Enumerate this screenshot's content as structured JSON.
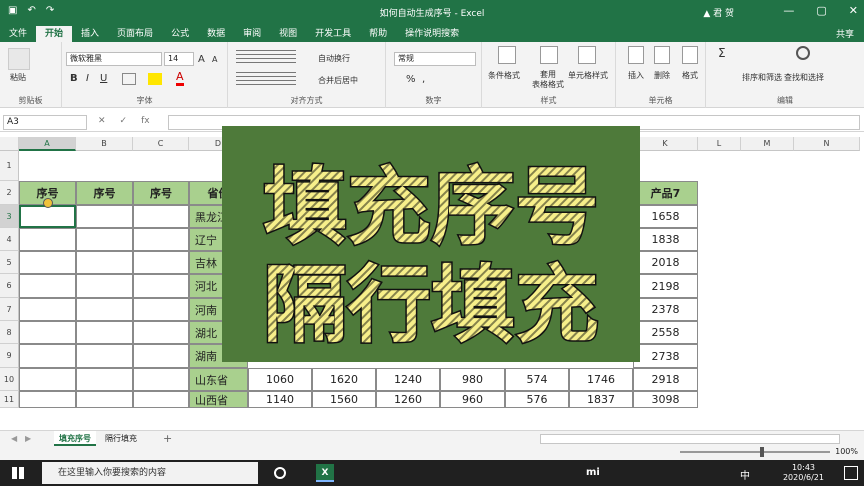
{
  "titlebar": {
    "title": "如何自动生成序号 - Excel",
    "user": "君 贺",
    "undo_icon": "↶",
    "redo_icon": "↷",
    "save_icon": "▣",
    "min_icon": "—",
    "max_icon": "▢",
    "close_icon": "✕",
    "warn_icon": "▲"
  },
  "tabs": [
    "文件",
    "开始",
    "插入",
    "页面布局",
    "公式",
    "数据",
    "审阅",
    "视图",
    "开发工具",
    "帮助",
    "操作说明搜索"
  ],
  "share": "共享",
  "ribbon": {
    "clipboard": {
      "label": "剪贴板",
      "paste": "粘贴"
    },
    "font": {
      "label": "字体",
      "name": "微软雅黑",
      "size": "14",
      "bold": "B",
      "italic": "I",
      "underline": "U",
      "grow": "A",
      "shrink": "A",
      "color": "A"
    },
    "align": {
      "label": "对齐方式",
      "wrap": "自动换行",
      "merge": "合并后居中"
    },
    "number": {
      "label": "数字",
      "format": "常规",
      "percent": "%",
      "comma": ","
    },
    "styles": {
      "label": "样式",
      "cond": "条件格式",
      "table": "套用\n表格格式",
      "cell": "单元格样式"
    },
    "cells": {
      "label": "单元格",
      "insert": "插入",
      "delete": "删除",
      "format": "格式"
    },
    "edit": {
      "label": "编辑",
      "sort": "排序和筛选",
      "find": "查找和选择",
      "sigma": "Σ"
    }
  },
  "formula_bar": {
    "namebox": "A3",
    "cancel": "✕",
    "enter": "✓",
    "fx": "fx",
    "value": ""
  },
  "columns": [
    "A",
    "B",
    "C",
    "D",
    "E",
    "F",
    "G",
    "H",
    "I",
    "J",
    "K",
    "L",
    "M",
    "N"
  ],
  "rows": [
    "1",
    "2",
    "3",
    "4",
    "5",
    "6",
    "7",
    "8",
    "9",
    "10",
    "11"
  ],
  "table": {
    "headers": [
      "序号",
      "序号",
      "序号",
      "省份",
      "产品7"
    ],
    "provinces": [
      "黑龙江",
      "辽宁",
      "吉林",
      "河北",
      "河南",
      "湖北",
      "湖南",
      "山东省",
      "山西省"
    ],
    "product7": [
      "1658",
      "1838",
      "2018",
      "2198",
      "2378",
      "2558",
      "2738",
      "2918",
      "3098"
    ],
    "row10": [
      "1060",
      "1620",
      "1240",
      "980",
      "574",
      "1746"
    ],
    "row11": [
      "1140",
      "1560",
      "1260",
      "960",
      "576",
      "1837"
    ]
  },
  "overlay": {
    "line1": "填充序号",
    "line2": "隔行填充"
  },
  "sheets": [
    "填充序号",
    "隔行填充"
  ],
  "add_sheet": "+",
  "status": {
    "zoom": "100%"
  },
  "taskbar": {
    "search_placeholder": "在这里输入你要搜索的内容",
    "mi": "mi",
    "ime": "中",
    "time": "10:43",
    "date": "2020/6/21",
    "excel_icon": "X"
  },
  "colors": {
    "excel_green": "#217346",
    "header_fill": "#a9d08e",
    "overlay_bg": "#4e7a3a",
    "overlay_text": "#f7ef8a"
  }
}
